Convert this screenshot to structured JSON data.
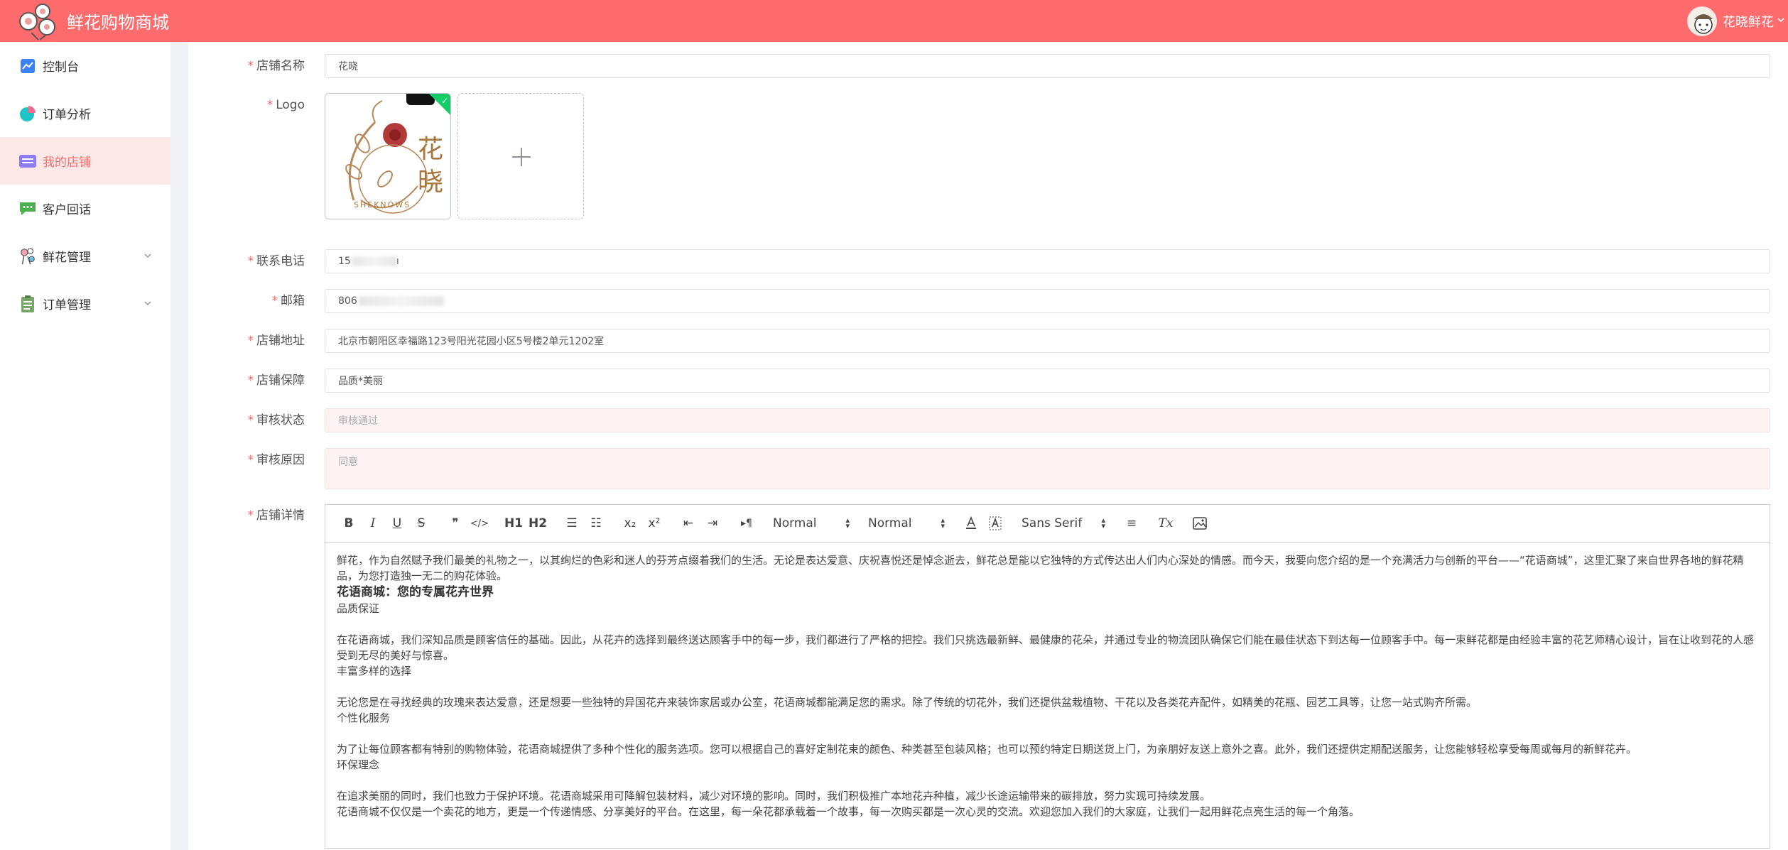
{
  "header": {
    "app_title": "鲜花购物商城",
    "user_name": "花晓鲜花",
    "colors": {
      "header_bg": "#fd6b6d",
      "active_text": "#fd6b6d",
      "active_bg": "#fde8e8"
    }
  },
  "sidebar": {
    "items": [
      {
        "label": "控制台",
        "icon": "chart-line-icon"
      },
      {
        "label": "订单分析",
        "icon": "pie-chart-icon"
      },
      {
        "label": "我的店铺",
        "icon": "store-icon",
        "active": true
      },
      {
        "label": "客户回话",
        "icon": "chat-bubble-icon"
      },
      {
        "label": "鲜花管理",
        "icon": "flower-person-icon",
        "expandable": true
      },
      {
        "label": "订单管理",
        "icon": "clipboard-icon",
        "expandable": true
      }
    ]
  },
  "form": {
    "shop_name": {
      "label": "店铺名称",
      "value": "花晓"
    },
    "logo": {
      "label": "Logo",
      "logo_text": "花晓",
      "logo_subtext": "SHEKNOWS"
    },
    "phone": {
      "label": "联系电话",
      "value_prefix": "15",
      "value_suffix": "ı"
    },
    "email": {
      "label": "邮箱",
      "value_prefix": "806"
    },
    "address": {
      "label": "店铺地址",
      "value": "北京市朝阳区幸福路123号阳光花园小区5号楼2单元1202室"
    },
    "guarantee": {
      "label": "店铺保障",
      "value": "品质*美丽"
    },
    "audit_status": {
      "label": "审核状态",
      "value": "审核通过"
    },
    "audit_reason": {
      "label": "审核原因",
      "value": "同意"
    },
    "details": {
      "label": "店铺详情"
    }
  },
  "editor": {
    "toolbar": {
      "bold": "B",
      "italic": "I",
      "underline": "U",
      "strike": "S",
      "quote": "❞",
      "code": "</>",
      "h1": "H1",
      "h2": "H2",
      "ordered_list": "☰",
      "bullet_list": "☷",
      "subscript": "x₂",
      "superscript": "x²",
      "outdent": "⇤",
      "indent": "⇥",
      "direction": "▸¶",
      "header_picker": "Normal",
      "size_picker": "Normal",
      "font_picker": "Sans Serif",
      "align": "≡",
      "clean": "Tx",
      "image": "▣"
    },
    "content": {
      "p1": "鲜花，作为自然赋予我们最美的礼物之一，以其绚烂的色彩和迷人的芬芳点缀着我们的生活。无论是表达爱意、庆祝喜悦还是悼念逝去，鲜花总是能以它独特的方式传达出人们内心深处的情感。而今天，我要向您介绍的是一个充满活力与创新的平台——“花语商城”，这里汇聚了来自世界各地的鲜花精品，为您打造独一无二的购花体验。",
      "h_title": "花语商城：您的专属花卉世界",
      "s1": "品质保证",
      "p2": "在花语商城，我们深知品质是顾客信任的基础。因此，从花卉的选择到最终送达顾客手中的每一步，我们都进行了严格的把控。我们只挑选最新鲜、最健康的花朵，并通过专业的物流团队确保它们能在最佳状态下到达每一位顾客手中。每一束鲜花都是由经验丰富的花艺师精心设计，旨在让收到花的人感受到无尽的美好与惊喜。",
      "s2": "丰富多样的选择",
      "p3": "无论您是在寻找经典的玫瑰来表达爱意，还是想要一些独特的异国花卉来装饰家居或办公室，花语商城都能满足您的需求。除了传统的切花外，我们还提供盆栽植物、干花以及各类花卉配件，如精美的花瓶、园艺工具等，让您一站式购齐所需。",
      "s3": "个性化服务",
      "p4": "为了让每位顾客都有特别的购物体验，花语商城提供了多种个性化的服务选项。您可以根据自己的喜好定制花束的颜色、种类甚至包装风格；也可以预约特定日期送货上门，为亲朋好友送上意外之喜。此外，我们还提供定期配送服务，让您能够轻松享受每周或每月的新鲜花卉。",
      "s4": "环保理念",
      "p5": "在追求美丽的同时，我们也致力于保护环境。花语商城采用可降解包装材料，减少对环境的影响。同时，我们积极推广本地花卉种植，减少长途运输带来的碳排放，努力实现可持续发展。",
      "p6": "花语商城不仅仅是一个卖花的地方，更是一个传递情感、分享美好的平台。在这里，每一朵花都承载着一个故事，每一次购买都是一次心灵的交流。欢迎您加入我们的大家庭，让我们一起用鲜花点亮生活的每一个角落。"
    }
  }
}
